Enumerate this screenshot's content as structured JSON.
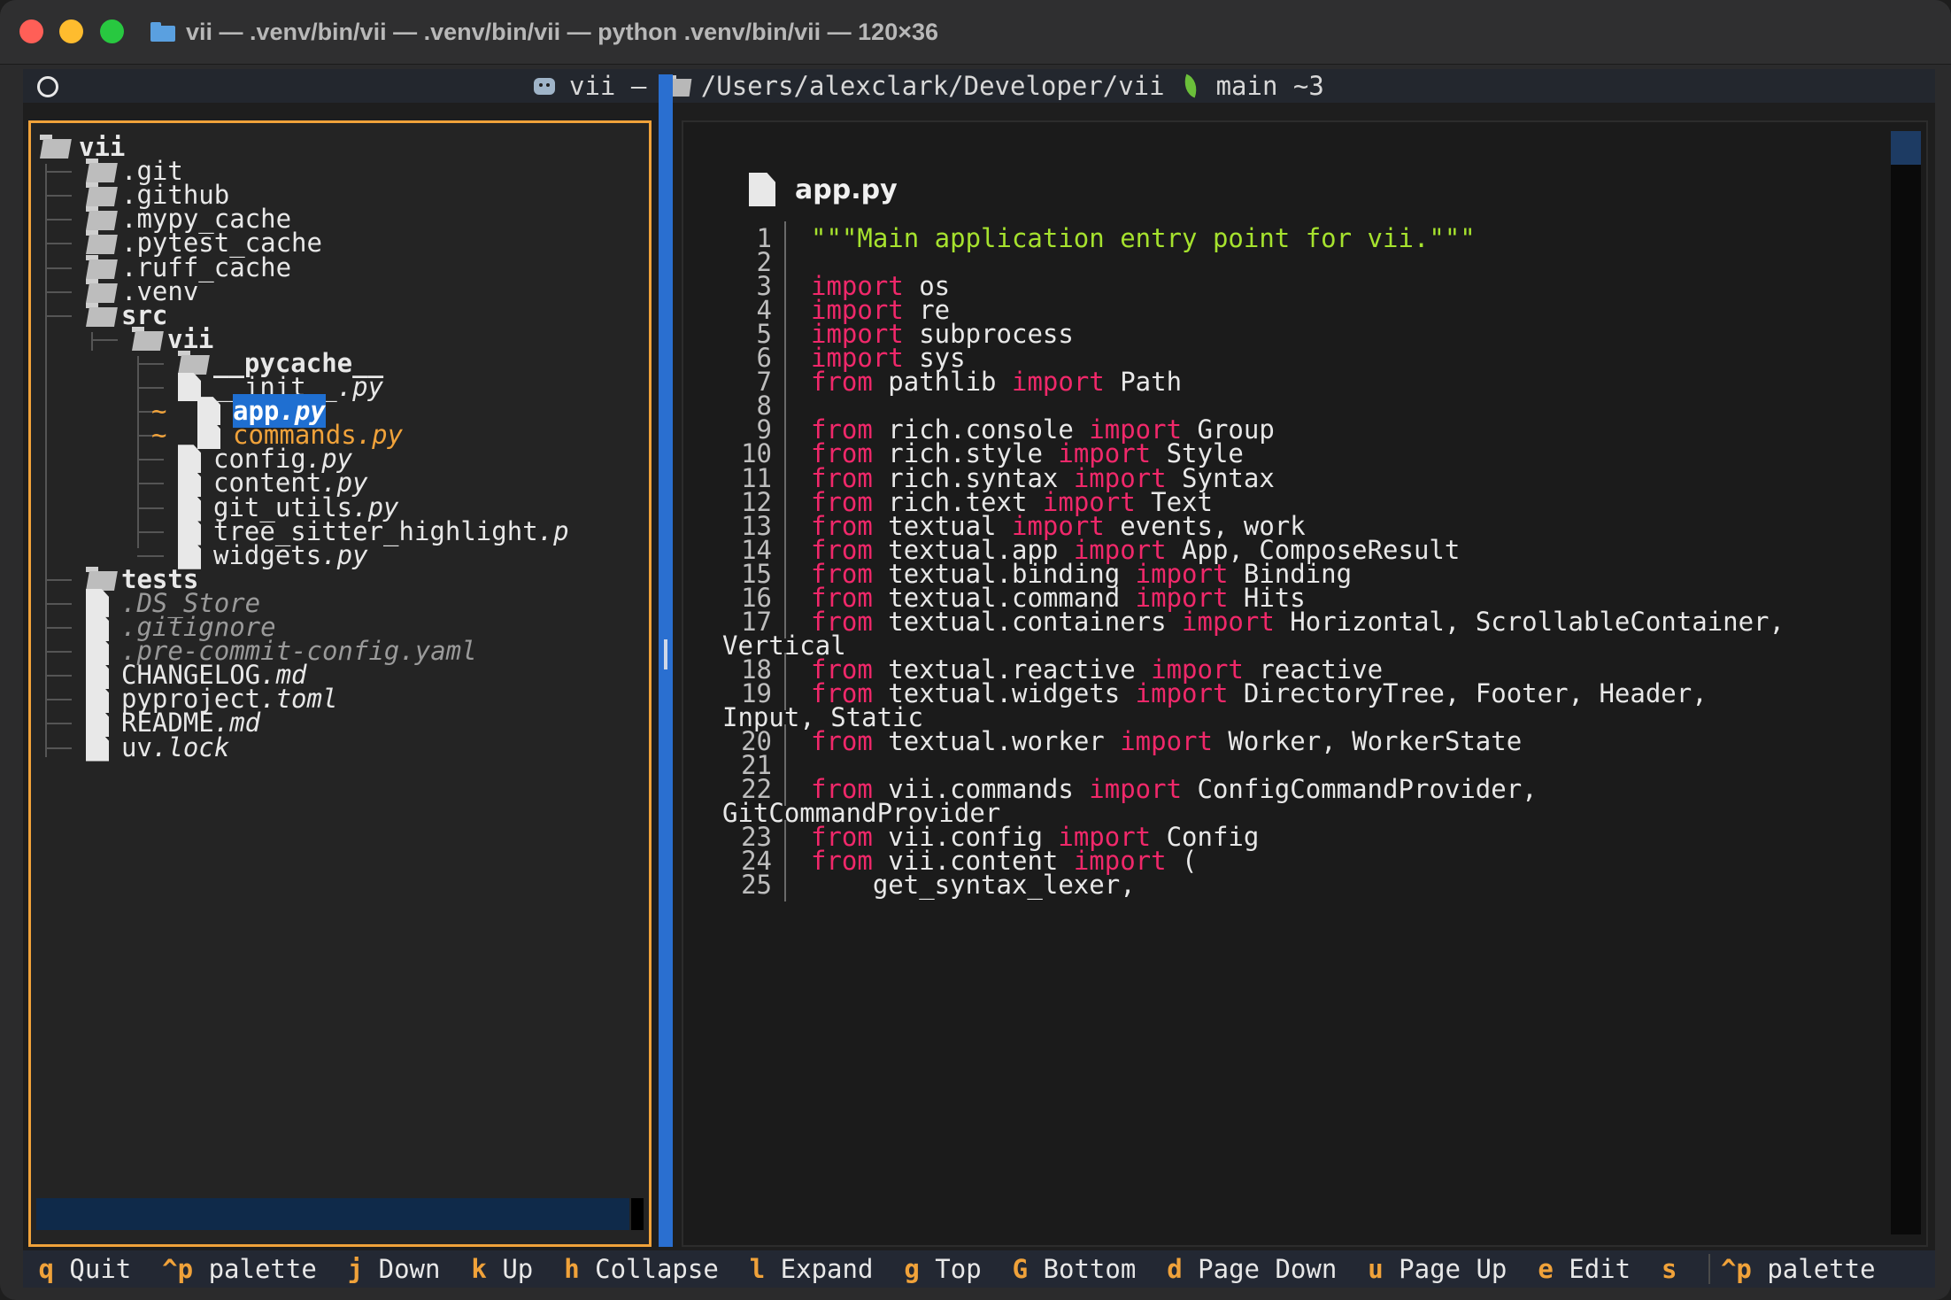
{
  "window": {
    "title": "vii — .venv/bin/vii — .venv/bin/vii — python .venv/bin/vii — 120×36"
  },
  "header": {
    "app_name": "vii",
    "separator": "–",
    "path": "/Users/alexclark/Developer/vii",
    "branch": "main ~3"
  },
  "tree": {
    "root": "vii",
    "items": [
      {
        "label": "",
        "name": ".git",
        "type": "folder",
        "depth": 1
      },
      {
        "label": "",
        "name": ".github",
        "type": "folder",
        "depth": 1
      },
      {
        "label": "",
        "name": ".mypy_cache",
        "type": "folder",
        "depth": 1
      },
      {
        "label": "",
        "name": ".pytest_cache",
        "type": "folder",
        "depth": 1
      },
      {
        "label": "",
        "name": ".ruff_cache",
        "type": "folder",
        "depth": 1
      },
      {
        "label": "",
        "name": ".venv",
        "type": "folder",
        "depth": 1
      },
      {
        "label": "",
        "name": "src",
        "type": "folder",
        "depth": 1
      },
      {
        "label": "",
        "name": "vii",
        "type": "folder",
        "depth": 2
      },
      {
        "label": "",
        "name": "__pycache__",
        "type": "folder",
        "depth": 3
      },
      {
        "stem": "__init__",
        "ext": ".py",
        "type": "file",
        "depth": 3
      },
      {
        "stem": "app",
        "ext": ".py",
        "type": "file",
        "depth": 3,
        "modified": "~",
        "selected": true
      },
      {
        "stem": "commands",
        "ext": ".py",
        "type": "file",
        "depth": 3,
        "modified": "~"
      },
      {
        "stem": "config",
        "ext": ".py",
        "type": "file",
        "depth": 3
      },
      {
        "stem": "content",
        "ext": ".py",
        "type": "file",
        "depth": 3
      },
      {
        "stem": "git_utils",
        "ext": ".py",
        "type": "file",
        "depth": 3
      },
      {
        "stem": "tree_sitter_highlight",
        "ext": ".p",
        "type": "file",
        "depth": 3
      },
      {
        "stem": "widgets",
        "ext": ".py",
        "type": "file",
        "depth": 3
      },
      {
        "label": "",
        "name": "tests",
        "type": "folder",
        "depth": 1
      },
      {
        "stem": ".DS_Store",
        "ext": "",
        "type": "file",
        "depth": 1,
        "dim": true
      },
      {
        "stem": ".gitignore",
        "ext": "",
        "type": "file",
        "depth": 1,
        "dim": true
      },
      {
        "stem": ".pre-commit-config.yaml",
        "ext": "",
        "type": "file",
        "depth": 1,
        "dim": true
      },
      {
        "stem": "CHANGELOG",
        "ext": ".md",
        "type": "file",
        "depth": 1
      },
      {
        "stem": "pyproject",
        "ext": ".toml",
        "type": "file",
        "depth": 1
      },
      {
        "stem": "README",
        "ext": ".md",
        "type": "file",
        "depth": 1
      },
      {
        "stem": "uv",
        "ext": ".lock",
        "type": "file",
        "depth": 1
      }
    ]
  },
  "editor": {
    "filename": "app.py",
    "lines": [
      {
        "n": "1",
        "parts": [
          [
            "str",
            "\"\"\"Main application entry point for vii.\"\"\""
          ]
        ]
      },
      {
        "n": "2",
        "parts": []
      },
      {
        "n": "3",
        "parts": [
          [
            "kw",
            "import"
          ],
          [
            "",
            " os"
          ]
        ]
      },
      {
        "n": "4",
        "parts": [
          [
            "kw",
            "import"
          ],
          [
            "",
            " re"
          ]
        ]
      },
      {
        "n": "5",
        "parts": [
          [
            "kw",
            "import"
          ],
          [
            "",
            " subprocess"
          ]
        ]
      },
      {
        "n": "6",
        "parts": [
          [
            "kw",
            "import"
          ],
          [
            "",
            " sys"
          ]
        ]
      },
      {
        "n": "7",
        "parts": [
          [
            "kw",
            "from"
          ],
          [
            "",
            " pathlib "
          ],
          [
            "kw",
            "import"
          ],
          [
            "",
            " Path"
          ]
        ]
      },
      {
        "n": "8",
        "parts": []
      },
      {
        "n": "9",
        "parts": [
          [
            "kw",
            "from"
          ],
          [
            "",
            " rich.console "
          ],
          [
            "kw",
            "import"
          ],
          [
            "",
            " Group"
          ]
        ]
      },
      {
        "n": "10",
        "parts": [
          [
            "kw",
            "from"
          ],
          [
            "",
            " rich.style "
          ],
          [
            "kw",
            "import"
          ],
          [
            "",
            " Style"
          ]
        ]
      },
      {
        "n": "11",
        "parts": [
          [
            "kw",
            "from"
          ],
          [
            "",
            " rich.syntax "
          ],
          [
            "kw",
            "import"
          ],
          [
            "",
            " Syntax"
          ]
        ]
      },
      {
        "n": "12",
        "parts": [
          [
            "kw",
            "from"
          ],
          [
            "",
            " rich.text "
          ],
          [
            "kw",
            "import"
          ],
          [
            "",
            " Text"
          ]
        ]
      },
      {
        "n": "13",
        "parts": [
          [
            "kw",
            "from"
          ],
          [
            "",
            " textual "
          ],
          [
            "kw",
            "import"
          ],
          [
            "",
            " events, work"
          ]
        ]
      },
      {
        "n": "14",
        "parts": [
          [
            "kw",
            "from"
          ],
          [
            "",
            " textual.app "
          ],
          [
            "kw",
            "import"
          ],
          [
            "",
            " App, ComposeResult"
          ]
        ]
      },
      {
        "n": "15",
        "parts": [
          [
            "kw",
            "from"
          ],
          [
            "",
            " textual.binding "
          ],
          [
            "kw",
            "import"
          ],
          [
            "",
            " Binding"
          ]
        ]
      },
      {
        "n": "16",
        "parts": [
          [
            "kw",
            "from"
          ],
          [
            "",
            " textual.command "
          ],
          [
            "kw",
            "import"
          ],
          [
            "",
            " Hits"
          ]
        ]
      },
      {
        "n": "17",
        "parts": [
          [
            "kw",
            "from"
          ],
          [
            "",
            " textual.containers "
          ],
          [
            "kw",
            "import"
          ],
          [
            "",
            " Horizontal, ScrollableContainer,"
          ]
        ],
        "wrap": "Vertical"
      },
      {
        "n": "18",
        "parts": [
          [
            "kw",
            "from"
          ],
          [
            "",
            " textual.reactive "
          ],
          [
            "kw",
            "import"
          ],
          [
            "",
            " reactive"
          ]
        ]
      },
      {
        "n": "19",
        "parts": [
          [
            "kw",
            "from"
          ],
          [
            "",
            " textual.widgets "
          ],
          [
            "kw",
            "import"
          ],
          [
            "",
            " DirectoryTree, Footer, Header,"
          ]
        ],
        "wrap": "Input, Static"
      },
      {
        "n": "20",
        "parts": [
          [
            "kw",
            "from"
          ],
          [
            "",
            " textual.worker "
          ],
          [
            "kw",
            "import"
          ],
          [
            "",
            " Worker, WorkerState"
          ]
        ]
      },
      {
        "n": "21",
        "parts": []
      },
      {
        "n": "22",
        "parts": [
          [
            "kw",
            "from"
          ],
          [
            "",
            " vii.commands "
          ],
          [
            "kw",
            "import"
          ],
          [
            "",
            " ConfigCommandProvider,"
          ]
        ],
        "wrap": "GitCommandProvider"
      },
      {
        "n": "23",
        "parts": [
          [
            "kw",
            "from"
          ],
          [
            "",
            " vii.config "
          ],
          [
            "kw",
            "import"
          ],
          [
            "",
            " Config"
          ]
        ]
      },
      {
        "n": "24",
        "parts": [
          [
            "kw",
            "from"
          ],
          [
            "",
            " vii.content "
          ],
          [
            "kw",
            "import"
          ],
          [
            "",
            " ("
          ]
        ]
      },
      {
        "n": "25",
        "parts": [
          [
            "",
            "    get_syntax_lexer,"
          ]
        ]
      }
    ]
  },
  "footer": {
    "bindings": [
      {
        "key": "q",
        "label": "Quit"
      },
      {
        "key": "^p",
        "label": "palette"
      },
      {
        "key": "j",
        "label": "Down"
      },
      {
        "key": "k",
        "label": "Up"
      },
      {
        "key": "h",
        "label": "Collapse"
      },
      {
        "key": "l",
        "label": "Expand"
      },
      {
        "key": "g",
        "label": "Top"
      },
      {
        "key": "G",
        "label": "Bottom"
      },
      {
        "key": "d",
        "label": "Page Down"
      },
      {
        "key": "u",
        "label": "Page Up"
      },
      {
        "key": "e",
        "label": "Edit"
      },
      {
        "key": "s",
        "label": ""
      }
    ],
    "palette_key": "^p",
    "palette_label": "palette"
  },
  "colors": {
    "accent_orange": "#f0a23a",
    "keyword": "#f0286a",
    "string": "#a6e22e",
    "selection": "#1f6fd1",
    "divider": "#2a6fd0"
  }
}
